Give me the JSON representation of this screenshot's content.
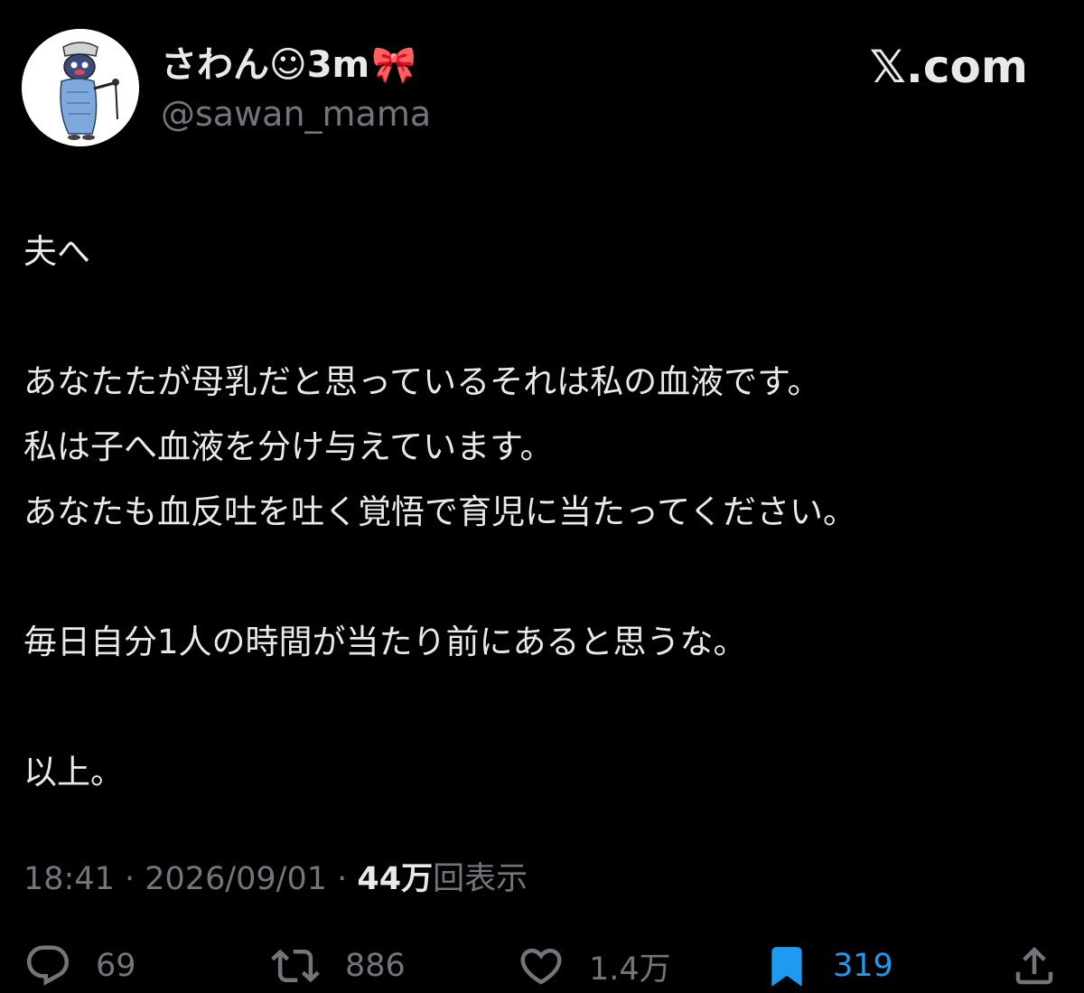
{
  "header": {
    "display_name": "さわん☺︎3m",
    "display_name_emoji": "🎀",
    "handle": "@sawan_mama",
    "brand": "𝕏.com",
    "avatar_icon": "cartoon-character-avatar"
  },
  "tweet": {
    "lines": [
      "夫へ",
      "",
      "あなたたが母乳だと思っているそれは私の血液です。",
      "私は子へ血液を分け与えています。",
      "あなたも血反吐を吐く覚悟で育児に当たってください。",
      "",
      "毎日自分1人の時間が当たり前にあると思うな。",
      "",
      "以上。"
    ]
  },
  "meta": {
    "time": "18:41",
    "separator": " · ",
    "date": "2026/09/01",
    "views_count": "44万",
    "views_label": "回表示"
  },
  "actions": {
    "reply_count": "69",
    "repost_count": "886",
    "like_count": "1.4万",
    "bookmark_count": "319",
    "reply_icon": "reply-icon",
    "repost_icon": "repost-icon",
    "like_icon": "heart-icon",
    "bookmark_icon": "bookmark-icon",
    "share_icon": "share-icon"
  },
  "colors": {
    "background": "#000000",
    "text_primary": "#e7e9ea",
    "text_secondary": "#71767b",
    "accent": "#1d9bf0"
  }
}
